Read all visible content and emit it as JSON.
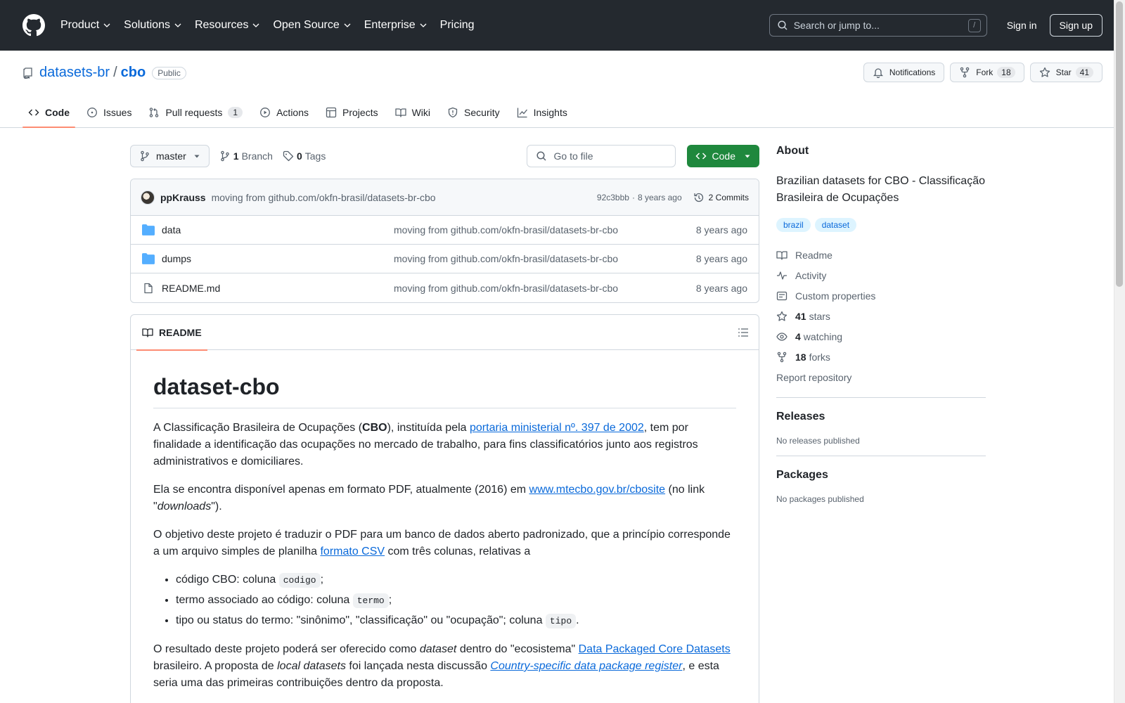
{
  "header": {
    "nav": [
      "Product",
      "Solutions",
      "Resources",
      "Open Source",
      "Enterprise",
      "Pricing"
    ],
    "search_placeholder": "Search or jump to...",
    "slash_key": "/",
    "sign_in": "Sign in",
    "sign_up": "Sign up"
  },
  "repo": {
    "owner": "datasets-br",
    "separator": "/",
    "name": "cbo",
    "visibility": "Public",
    "notifications_label": "Notifications",
    "fork_label": "Fork",
    "fork_count": "18",
    "star_label": "Star",
    "star_count": "41"
  },
  "tabs": [
    {
      "label": "Code",
      "icon": "code-icon",
      "active": true
    },
    {
      "label": "Issues",
      "icon": "issue-icon"
    },
    {
      "label": "Pull requests",
      "icon": "pull-request-icon",
      "count": "1"
    },
    {
      "label": "Actions",
      "icon": "play-icon"
    },
    {
      "label": "Projects",
      "icon": "table-icon"
    },
    {
      "label": "Wiki",
      "icon": "book-icon"
    },
    {
      "label": "Security",
      "icon": "shield-icon"
    },
    {
      "label": "Insights",
      "icon": "graph-icon"
    }
  ],
  "toolbar": {
    "branch": "master",
    "branch_count": "1",
    "branch_label": "Branch",
    "tag_count": "0",
    "tag_label": "Tags",
    "goto_placeholder": "Go to file",
    "code_button": "Code"
  },
  "latest_commit": {
    "author": "ppKrauss",
    "message": "moving from github.com/okfn-brasil/datasets-br-cbo",
    "hash": "92c3bbb",
    "dot": "·",
    "age": "8 years ago",
    "commits_label": "2 Commits"
  },
  "files": [
    {
      "name": "data",
      "type": "folder",
      "message": "moving from github.com/okfn-brasil/datasets-br-cbo",
      "age": "8 years ago"
    },
    {
      "name": "dumps",
      "type": "folder",
      "message": "moving from github.com/okfn-brasil/datasets-br-cbo",
      "age": "8 years ago"
    },
    {
      "name": "README.md",
      "type": "file",
      "message": "moving from github.com/okfn-brasil/datasets-br-cbo",
      "age": "8 years ago"
    }
  ],
  "readme": {
    "tab_label": "README",
    "title": "dataset-cbo",
    "p1_a": "A Classificação Brasileira de Ocupações (",
    "p1_b": "CBO",
    "p1_c": "), instituída pela ",
    "p1_link": "portaria ministerial nº. 397 de 2002",
    "p1_d": ", tem por finalidade a identificação das ocupações no mercado de trabalho, para fins classificatórios junto aos registros administrativos e domiciliares.",
    "p2_a": "Ela se encontra disponível apenas em formato PDF, atualmente (2016) em ",
    "p2_link": "www.mtecbo.gov.br/cbosite",
    "p2_b": " (no link \"",
    "p2_em": "downloads",
    "p2_c": "\").",
    "p3_a": "O objetivo deste projeto é traduzir o PDF para um banco de dados aberto padronizado, que a princípio corresponde a um arquivo simples de planilha ",
    "p3_link": "formato CSV",
    "p3_b": " com três colunas, relativas a",
    "li1_text": "código CBO: coluna ",
    "li1_code": "codigo",
    "li1_end": ";",
    "li2_text": "termo associado ao código: coluna ",
    "li2_code": "termo",
    "li2_end": ";",
    "li3_text": "tipo ou status do termo: \"sinônimo\", \"classificação\" ou \"ocupação\"; coluna ",
    "li3_code": "tipo",
    "li3_end": ".",
    "p4_a": "O resultado deste projeto poderá ser oferecido como ",
    "p4_em1": "dataset",
    "p4_b": " dentro do \"ecosistema\" ",
    "p4_link1": "Data Packaged Core Datasets",
    "p4_c": " brasileiro. A proposta de ",
    "p4_em2": "local datasets",
    "p4_d": " foi lançada nesta discussão ",
    "p4_link2": "Country-specific data package register",
    "p4_e": ", e esta seria uma das primeiras contribuições dentro da proposta."
  },
  "about": {
    "heading": "About",
    "description": "Brazilian datasets for CBO - Classificação Brasileira de Ocupações",
    "topics": [
      "brazil",
      "dataset"
    ],
    "links": [
      {
        "icon": "book-icon",
        "label": "Readme"
      },
      {
        "icon": "pulse-icon",
        "label": "Activity"
      },
      {
        "icon": "note-icon",
        "label": "Custom properties"
      },
      {
        "icon": "star-icon",
        "count": "41",
        "label": "stars"
      },
      {
        "icon": "eye-icon",
        "count": "4",
        "label": "watching"
      },
      {
        "icon": "fork-icon",
        "count": "18",
        "label": "forks"
      }
    ],
    "report": "Report repository",
    "releases_heading": "Releases",
    "releases_text": "No releases published",
    "packages_heading": "Packages",
    "packages_text": "No packages published"
  },
  "colors": {
    "accent": "#0969da",
    "primary_button": "#1f883d",
    "header_bg": "#24292f",
    "tab_underline": "#fd8c73"
  }
}
